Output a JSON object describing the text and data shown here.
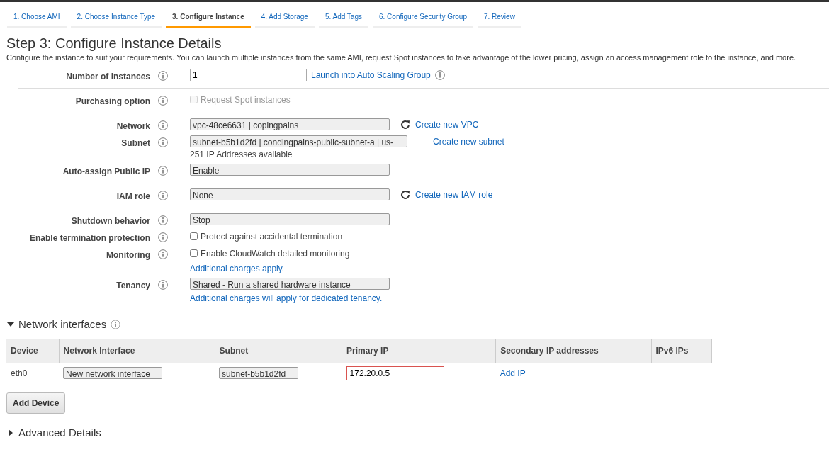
{
  "tabs": [
    {
      "label": "1. Choose AMI",
      "selected": false
    },
    {
      "label": "2. Choose Instance Type",
      "selected": false
    },
    {
      "label": "3. Configure Instance",
      "selected": true
    },
    {
      "label": "4. Add Storage",
      "selected": false
    },
    {
      "label": "5. Add Tags",
      "selected": false
    },
    {
      "label": "6. Configure Security Group",
      "selected": false
    },
    {
      "label": "7. Review",
      "selected": false
    }
  ],
  "heading": "Step 3: Configure Instance Details",
  "description": "Configure the instance to suit your requirements. You can launch multiple instances from the same AMI, request Spot instances to take advantage of the lower pricing, assign an access management role to the instance, and more.",
  "form_groups": [
    {
      "rows": [
        {
          "label": "Number of instances",
          "kind": "text",
          "value": "1",
          "link": "Launch into Auto Scaling Group",
          "link_info": true
        }
      ]
    },
    {
      "rows": [
        {
          "label": "Purchasing option",
          "kind": "checkbox",
          "checked": false,
          "disabled": true,
          "text": "Request Spot instances"
        }
      ]
    },
    {
      "rows": [
        {
          "label": "Network",
          "kind": "select",
          "value": "vpc-48ce6631 | copingpains",
          "refresh": true,
          "link": "Create new VPC"
        },
        {
          "label": "Subnet",
          "kind": "select",
          "value": "subnet-b5b1d2fd | condingpains-public-subnet-a | us-",
          "link": "Create new subnet",
          "note": "251 IP Addresses available"
        },
        {
          "label": "Auto-assign Public IP",
          "kind": "select",
          "value": "Enable"
        }
      ]
    },
    {
      "rows": [
        {
          "label": "IAM role",
          "kind": "select",
          "value": "None",
          "refresh": true,
          "link": "Create new IAM role"
        }
      ]
    },
    {
      "rows": [
        {
          "label": "Shutdown behavior",
          "kind": "select",
          "value": "Stop"
        },
        {
          "label": "Enable termination protection",
          "kind": "checkbox",
          "checked": false,
          "disabled": false,
          "text": "Protect against accidental termination"
        },
        {
          "label": "Monitoring",
          "kind": "checkbox",
          "checked": false,
          "disabled": false,
          "text": "Enable CloudWatch detailed monitoring",
          "note_link": "Additional charges apply."
        },
        {
          "label": "Tenancy",
          "kind": "select",
          "value": "Shared - Run a shared hardware instance",
          "note_link": "Additional charges will apply for dedicated tenancy."
        }
      ]
    }
  ],
  "network_interfaces": {
    "title": "Network interfaces",
    "expanded": true,
    "columns": [
      "Device",
      "Network Interface",
      "Subnet",
      "Primary IP",
      "Secondary IP addresses",
      "IPv6 IPs"
    ],
    "rows": [
      {
        "device": "eth0",
        "network_interface": "New network interface",
        "subnet": "subnet-b5b1d2fd",
        "primary_ip": "172.20.0.5",
        "invalid": true,
        "action": "Add IP"
      }
    ]
  },
  "add_device": "Add Device",
  "advanced": {
    "title": "Advanced Details",
    "expanded": false
  }
}
